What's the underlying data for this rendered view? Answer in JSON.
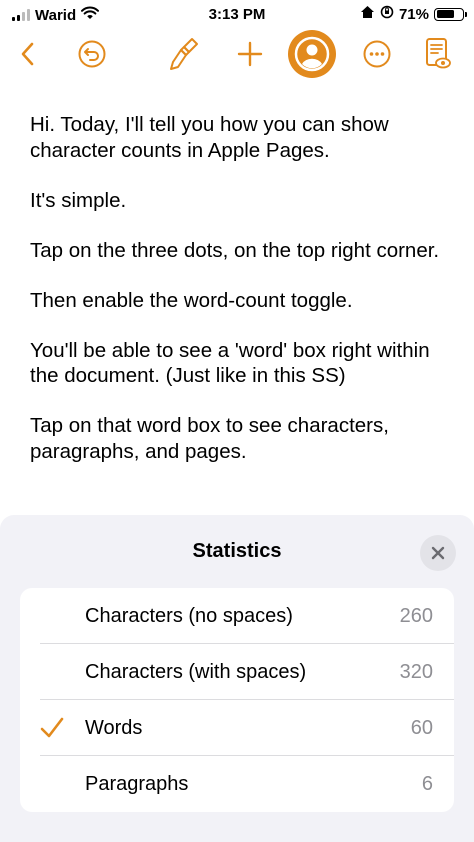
{
  "status_bar": {
    "carrier": "Warid",
    "time": "3:13 PM",
    "battery_percent": "71%",
    "battery_level": 0.71
  },
  "toolbar": {
    "accent_color": "#e28a1d",
    "icons": [
      "back-chevron-icon",
      "undo-icon",
      "paintbrush-icon",
      "add-icon",
      "collaborator-icon",
      "more-icon",
      "reading-view-icon"
    ]
  },
  "document": {
    "paragraphs": [
      "Hi. Today, I'll tell you how you can show character counts in Apple Pages.",
      "It's simple.",
      "Tap on the three dots, on the top right corner.",
      "Then enable the word-count toggle.",
      "You'll be able to see a 'word' box right within the document. (Just like in this SS)",
      "Tap on that word box to see characters, paragraphs, and pages."
    ]
  },
  "statistics": {
    "title": "Statistics",
    "rows": [
      {
        "label": "Characters (no spaces)",
        "value": "260",
        "checked": false
      },
      {
        "label": "Characters (with spaces)",
        "value": "320",
        "checked": false
      },
      {
        "label": "Words",
        "value": "60",
        "checked": true
      },
      {
        "label": "Paragraphs",
        "value": "6",
        "checked": false
      }
    ]
  }
}
